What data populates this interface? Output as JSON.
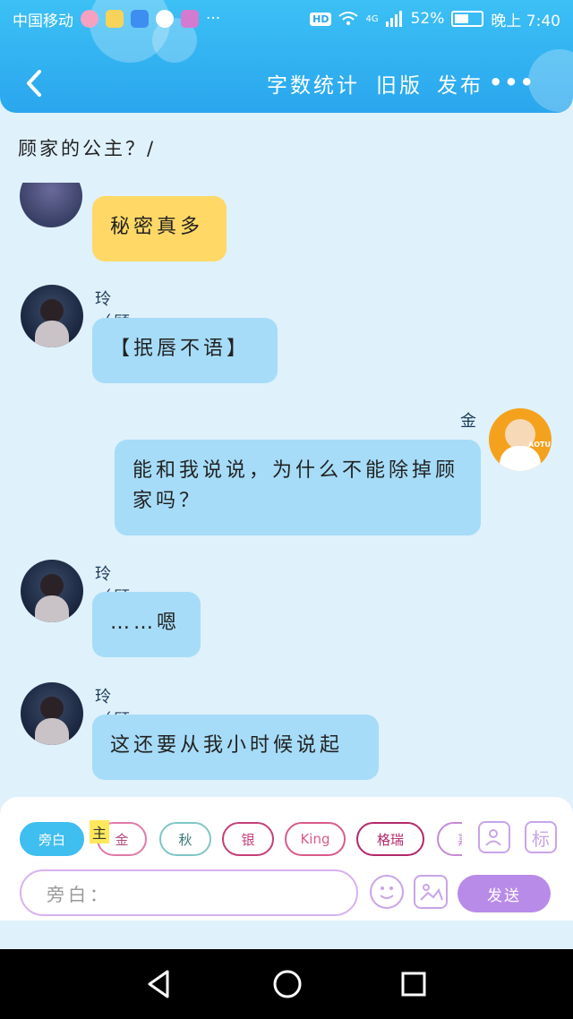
{
  "status_bar": {
    "carrier": "中国移动",
    "dots": "···",
    "hd": "HD",
    "signal": "4G",
    "battery": "52%",
    "time": "晚上 7:40"
  },
  "navbar": {
    "word_count": "字数统计",
    "old_version": "旧版",
    "publish": "发布",
    "more": "•••"
  },
  "topic_title": "顾家的公主？/",
  "messages": [
    {
      "speaker": "",
      "text": "秘密真多"
    },
    {
      "speaker": "玲 （顾梓潼）",
      "text": "【抿唇不语】"
    },
    {
      "speaker": "金",
      "text": "能和我说说，为什么不能除掉顾家吗？"
    },
    {
      "speaker": "玲 （顾梓潼）",
      "text": "……嗯"
    },
    {
      "speaker": "玲 （顾梓潼）",
      "text": "这还要从我小时候说起"
    }
  ],
  "avatar_badge": "AOTU",
  "roles": [
    {
      "label": "旁白",
      "color": "#3fbef0"
    },
    {
      "label": "金",
      "color": "#e07aa6"
    },
    {
      "label": "秋",
      "color": "#7fc6c6"
    },
    {
      "label": "银",
      "color": "#c43f78"
    },
    {
      "label": "King",
      "color": "#d95b8a"
    },
    {
      "label": "格瑞",
      "color": "#b3286a"
    },
    {
      "label": "嘉",
      "color": "#c68ad6"
    }
  ],
  "host_badge": "主",
  "tag_icon_label": "标",
  "input": {
    "placeholder": "旁白："
  },
  "send_label": "发送"
}
